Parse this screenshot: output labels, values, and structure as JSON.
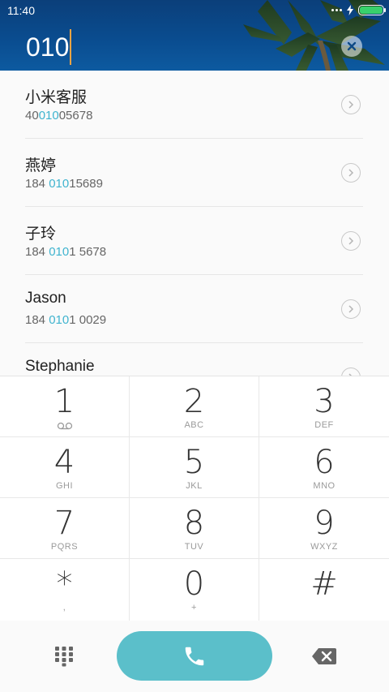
{
  "status_bar": {
    "time": "11:40"
  },
  "dialer": {
    "input_value": "010"
  },
  "contacts": [
    {
      "name": "小米客服",
      "number_pre": "40",
      "number_match": "010",
      "number_post": "05678"
    },
    {
      "name": "燕婷",
      "number_pre": "184 ",
      "number_match": "010",
      "number_post": "15689"
    },
    {
      "name": "子玲",
      "number_pre": "184 ",
      "number_match": "010",
      "number_post": "1 5678"
    },
    {
      "name": "Jason",
      "number_pre": "184 ",
      "number_match": "010",
      "number_post": "1 0029"
    },
    {
      "name": "Stephanie",
      "number_pre": "",
      "number_match": "",
      "number_post": ""
    }
  ],
  "keypad": [
    {
      "digit": "1",
      "letters": ""
    },
    {
      "digit": "2",
      "letters": "ABC"
    },
    {
      "digit": "3",
      "letters": "DEF"
    },
    {
      "digit": "4",
      "letters": "GHI"
    },
    {
      "digit": "5",
      "letters": "JKL"
    },
    {
      "digit": "6",
      "letters": "MNO"
    },
    {
      "digit": "7",
      "letters": "PQRS"
    },
    {
      "digit": "8",
      "letters": "TUV"
    },
    {
      "digit": "9",
      "letters": "WXYZ"
    },
    {
      "digit": "*",
      "letters": ","
    },
    {
      "digit": "0",
      "letters": "+"
    },
    {
      "digit": "#",
      "letters": ""
    }
  ],
  "icons": {
    "voicemail": "voicemail-icon",
    "wifi": "wifi-icon",
    "charging": "charging-icon",
    "battery": "battery-icon",
    "clear": "clear-icon",
    "chevron": "chevron-right-icon",
    "dialpad": "dialpad-icon",
    "call": "phone-icon",
    "backspace": "backspace-icon"
  },
  "colors": {
    "accent": "#5bbfca",
    "match_highlight": "#40b4cf",
    "cursor": "#f5a443",
    "battery": "#38d16c"
  }
}
